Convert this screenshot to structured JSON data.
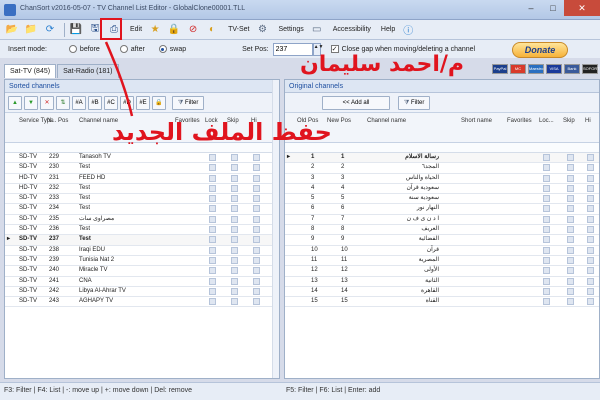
{
  "window": {
    "title": "ChanSort v2016-05-07 - TV Channel List Editor - GlobalClone00001.TLL",
    "min": "–",
    "max": "□",
    "close": "✕"
  },
  "menu": {
    "toolbar_icons": [
      "open-icon",
      "folder-icon",
      "reload-icon",
      "save-icon",
      "save-as-icon",
      "export-icon"
    ],
    "edit": "Edit",
    "tvset": "TV-Set",
    "settings": "Settings",
    "accessibility": "Accessibility",
    "help": "Help"
  },
  "options": {
    "insert_mode_label": "Insert mode:",
    "before": "before",
    "after": "after",
    "swap": "swap",
    "set_pos_label": "Set Pos:",
    "set_pos_value": "237",
    "close_gap_label": "Close gap when moving/deleting a channel"
  },
  "donate": {
    "label": "Donate",
    "cards": [
      {
        "name": "PayPal",
        "color": "#1c3f8c"
      },
      {
        "name": "MC",
        "color": "#d83a2a"
      },
      {
        "name": "Maestro",
        "color": "#2a6fc0"
      },
      {
        "name": "VISA",
        "color": "#1a3a9a"
      },
      {
        "name": "Bank",
        "color": "#3a5a9a"
      },
      {
        "name": "SOFORT",
        "color": "#222222"
      }
    ]
  },
  "tabs": [
    "Sat-TV (845)",
    "Sat-Radio (181)"
  ],
  "left_panel": {
    "title": "Sorted channels",
    "toolbar": [
      "▲",
      "▼",
      "✕",
      "⇅",
      "#A",
      "#B",
      "#C",
      "#D",
      "#E",
      "🔒"
    ],
    "filter_label": "Filter",
    "headers": {
      "service_type": "Service Type",
      "new_pos": "N... Pos",
      "channel_name": "Channel name",
      "favorites": "Favorites",
      "lock": "Lock",
      "skip": "Skip",
      "hide": "Hi"
    },
    "rows": [
      {
        "type": "SD-TV",
        "pos": "229",
        "name": "Tanasoh TV",
        "sel": false
      },
      {
        "type": "SD-TV",
        "pos": "230",
        "name": "Test",
        "sel": false
      },
      {
        "type": "HD-TV",
        "pos": "231",
        "name": "FEED HD",
        "sel": false
      },
      {
        "type": "HD-TV",
        "pos": "232",
        "name": "Test",
        "sel": false
      },
      {
        "type": "SD-TV",
        "pos": "233",
        "name": "Test",
        "sel": false
      },
      {
        "type": "SD-TV",
        "pos": "234",
        "name": "Test",
        "sel": false
      },
      {
        "type": "SD-TV",
        "pos": "235",
        "name": "مصراوى سات",
        "sel": false
      },
      {
        "type": "SD-TV",
        "pos": "236",
        "name": "Test",
        "sel": false
      },
      {
        "type": "SD-TV",
        "pos": "237",
        "name": "Test",
        "sel": true
      },
      {
        "type": "SD-TV",
        "pos": "238",
        "name": "Iraqi EDU",
        "sel": false
      },
      {
        "type": "SD-TV",
        "pos": "239",
        "name": "Tunisia Nat 2",
        "sel": false
      },
      {
        "type": "SD-TV",
        "pos": "240",
        "name": "Miracle TV",
        "sel": false
      },
      {
        "type": "SD-TV",
        "pos": "241",
        "name": "CNA",
        "sel": false
      },
      {
        "type": "SD-TV",
        "pos": "242",
        "name": "Libya Al-Ahrar TV",
        "sel": false
      },
      {
        "type": "SD-TV",
        "pos": "243",
        "name": "AGHAPY TV",
        "sel": false
      }
    ]
  },
  "right_panel": {
    "title": "Original channels",
    "add_all_label": "<< Add all",
    "filter_label": "Filter",
    "headers": {
      "old_pos": "Old Pos",
      "new_pos": "New Pos",
      "channel_name": "Channel name",
      "short_name": "Short name",
      "favorites": "Favorites",
      "lock": "Loc...",
      "skip": "Skip",
      "hide": "Hi"
    },
    "rows": [
      {
        "old": "1",
        "new": "1",
        "name": "رسالة الاسلام",
        "sel": true
      },
      {
        "old": "2",
        "new": "2",
        "name": "المجد٦",
        "sel": false
      },
      {
        "old": "3",
        "new": "3",
        "name": "الحياة والناس",
        "sel": false
      },
      {
        "old": "4",
        "new": "4",
        "name": "سعودية قرآن",
        "sel": false
      },
      {
        "old": "5",
        "new": "5",
        "name": "سعودية سنة",
        "sel": false
      },
      {
        "old": "6",
        "new": "6",
        "name": "النهار نور",
        "sel": false
      },
      {
        "old": "7",
        "new": "7",
        "name": "ا د ن ى ف ن",
        "sel": false
      },
      {
        "old": "8",
        "new": "8",
        "name": "العريف",
        "sel": false
      },
      {
        "old": "9",
        "new": "9",
        "name": "الفضائية",
        "sel": false
      },
      {
        "old": "10",
        "new": "10",
        "name": "قرآن",
        "sel": false
      },
      {
        "old": "11",
        "new": "11",
        "name": "المصرية",
        "sel": false
      },
      {
        "old": "12",
        "new": "12",
        "name": "الأولى",
        "sel": false
      },
      {
        "old": "13",
        "new": "13",
        "name": "الثانية",
        "sel": false
      },
      {
        "old": "14",
        "new": "14",
        "name": "القاهرة",
        "sel": false
      },
      {
        "old": "15",
        "new": "15",
        "name": "القناة",
        "sel": false
      }
    ]
  },
  "status": {
    "left": "F3: Filter | F4: List | -: move up | +: move down | Del: remove",
    "right": "F5: Filter | F6: List | Enter: add"
  },
  "annotations": {
    "author": "م/احمد سليمان",
    "save_note": "حفظ الملف الجديد"
  }
}
